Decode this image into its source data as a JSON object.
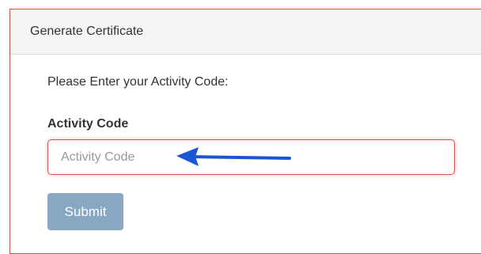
{
  "panel": {
    "title": "Generate Certificate"
  },
  "form": {
    "prompt": "Please Enter your Activity Code:",
    "field_label": "Activity Code",
    "input_placeholder": "Activity Code",
    "input_value": "",
    "submit_label": "Submit"
  },
  "annotation": {
    "arrow_icon": "arrow-left-icon",
    "arrow_color": "#1a55d6"
  },
  "colors": {
    "panel_border": "#c9553a",
    "input_border": "#d9534f",
    "submit_bg": "#88a7c2"
  }
}
